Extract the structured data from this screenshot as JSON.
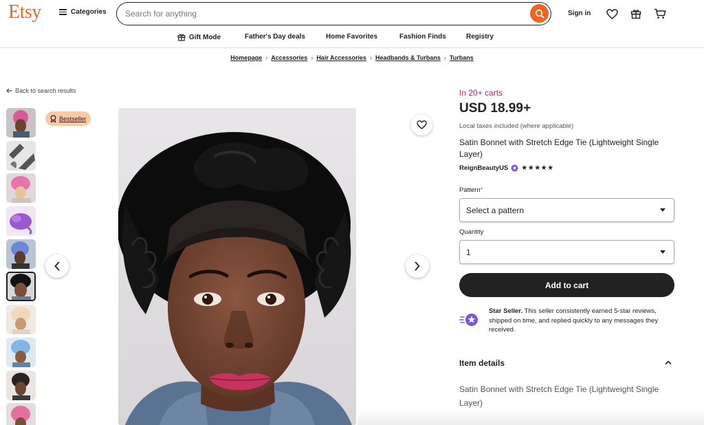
{
  "header": {
    "logo": "Etsy",
    "categories_label": "Categories",
    "search_placeholder": "Search for anything",
    "signin_label": "Sign in"
  },
  "nav": {
    "items": [
      {
        "label": "Gift Mode",
        "icon": "gift-icon"
      },
      {
        "label": "Father's Day deals"
      },
      {
        "label": "Home Favorites"
      },
      {
        "label": "Fashion Finds"
      },
      {
        "label": "Registry"
      }
    ]
  },
  "breadcrumb": [
    "Homepage",
    "Accessories",
    "Hair Accessories",
    "Headbands & Turbans",
    "Turbans"
  ],
  "back_label": "Back to search results",
  "gallery": {
    "badge": "Bestseller",
    "thumbnail_count": 10,
    "active_index": 5
  },
  "product": {
    "carts_text": "In 20+ carts",
    "price": "USD 18.99+",
    "tax_note": "Local taxes included (where applicable)",
    "title": "Satin Bonnet with Stretch Edge Tie (Lightweight Single Layer)",
    "seller": "ReignBeautyUS",
    "rating_stars": 5,
    "stars_text": "★★★★★"
  },
  "options": {
    "pattern_label": "Pattern",
    "required_mark": "*",
    "pattern_value": "Select a pattern",
    "quantity_label": "Quantity",
    "quantity_value": "1"
  },
  "add_to_cart_label": "Add to cart",
  "star_seller": {
    "title": "Star Seller.",
    "text": "This seller consistently earned 5-star reviews, shipped on time, and replied quickly to any messages they received."
  },
  "item_details": {
    "heading": "Item details",
    "description": "Satin Bonnet with Stretch Edge Tie (Lightweight Single Layer)"
  },
  "colors": {
    "brand": "#F1641E",
    "carts": "#B8266C",
    "badge_bg": "#F9C9A8",
    "button": "#222222",
    "star_seller": "#7C56D8"
  }
}
